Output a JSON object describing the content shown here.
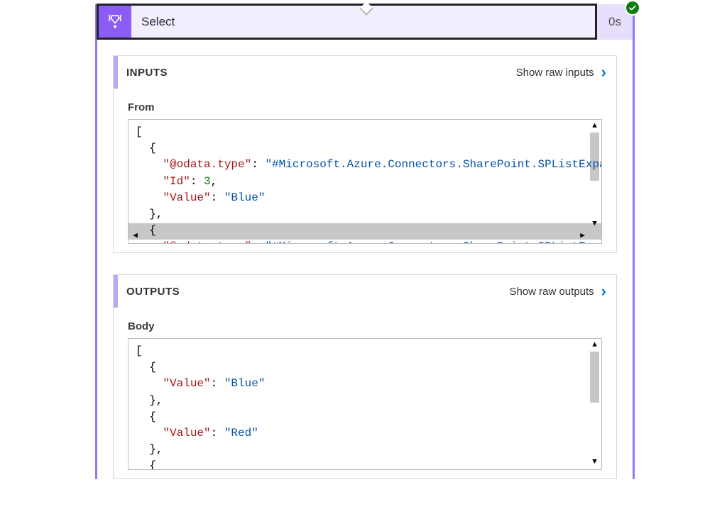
{
  "action": {
    "title": "Select",
    "icon_name": "data-operations-icon",
    "status": "success",
    "duration_label": "0s"
  },
  "panels": {
    "inputs": {
      "title": "INPUTS",
      "raw_link_label": "Show raw inputs",
      "field_label": "From",
      "code_tokens": [
        [
          "punc",
          "["
        ],
        [
          "nl",
          ""
        ],
        [
          "indent",
          "  "
        ],
        [
          "punc",
          "{"
        ],
        [
          "nl",
          ""
        ],
        [
          "indent",
          "    "
        ],
        [
          "key",
          "\"@odata.type\""
        ],
        [
          "punc",
          ": "
        ],
        [
          "str",
          "\"#Microsoft.Azure.Connectors.SharePoint.SPListExpand"
        ],
        [
          "nl",
          ""
        ],
        [
          "indent",
          "    "
        ],
        [
          "key",
          "\"Id\""
        ],
        [
          "punc",
          ": "
        ],
        [
          "num",
          "3"
        ],
        [
          "punc",
          ","
        ],
        [
          "nl",
          ""
        ],
        [
          "indent",
          "    "
        ],
        [
          "key",
          "\"Value\""
        ],
        [
          "punc",
          ": "
        ],
        [
          "str",
          "\"Blue\""
        ],
        [
          "nl",
          ""
        ],
        [
          "indent",
          "  "
        ],
        [
          "punc",
          "},"
        ],
        [
          "nl",
          ""
        ],
        [
          "indent",
          "  "
        ],
        [
          "punc",
          "{"
        ],
        [
          "nl",
          ""
        ],
        [
          "indent",
          "    "
        ],
        [
          "key",
          "\"@odata.type\""
        ],
        [
          "punc",
          ": "
        ],
        [
          "str",
          "\"#Microsoft.Azure.Connectors.SharePoint.SPListExpand"
        ],
        [
          "nl",
          ""
        ]
      ]
    },
    "outputs": {
      "title": "OUTPUTS",
      "raw_link_label": "Show raw outputs",
      "field_label": "Body",
      "code_tokens": [
        [
          "punc",
          "["
        ],
        [
          "nl",
          ""
        ],
        [
          "indent",
          "  "
        ],
        [
          "punc",
          "{"
        ],
        [
          "nl",
          ""
        ],
        [
          "indent",
          "    "
        ],
        [
          "key",
          "\"Value\""
        ],
        [
          "punc",
          ": "
        ],
        [
          "str",
          "\"Blue\""
        ],
        [
          "nl",
          ""
        ],
        [
          "indent",
          "  "
        ],
        [
          "punc",
          "},"
        ],
        [
          "nl",
          ""
        ],
        [
          "indent",
          "  "
        ],
        [
          "punc",
          "{"
        ],
        [
          "nl",
          ""
        ],
        [
          "indent",
          "    "
        ],
        [
          "key",
          "\"Value\""
        ],
        [
          "punc",
          ": "
        ],
        [
          "str",
          "\"Red\""
        ],
        [
          "nl",
          ""
        ],
        [
          "indent",
          "  "
        ],
        [
          "punc",
          "},"
        ],
        [
          "nl",
          ""
        ],
        [
          "indent",
          "  "
        ],
        [
          "punc",
          "{"
        ],
        [
          "nl",
          ""
        ]
      ]
    }
  }
}
